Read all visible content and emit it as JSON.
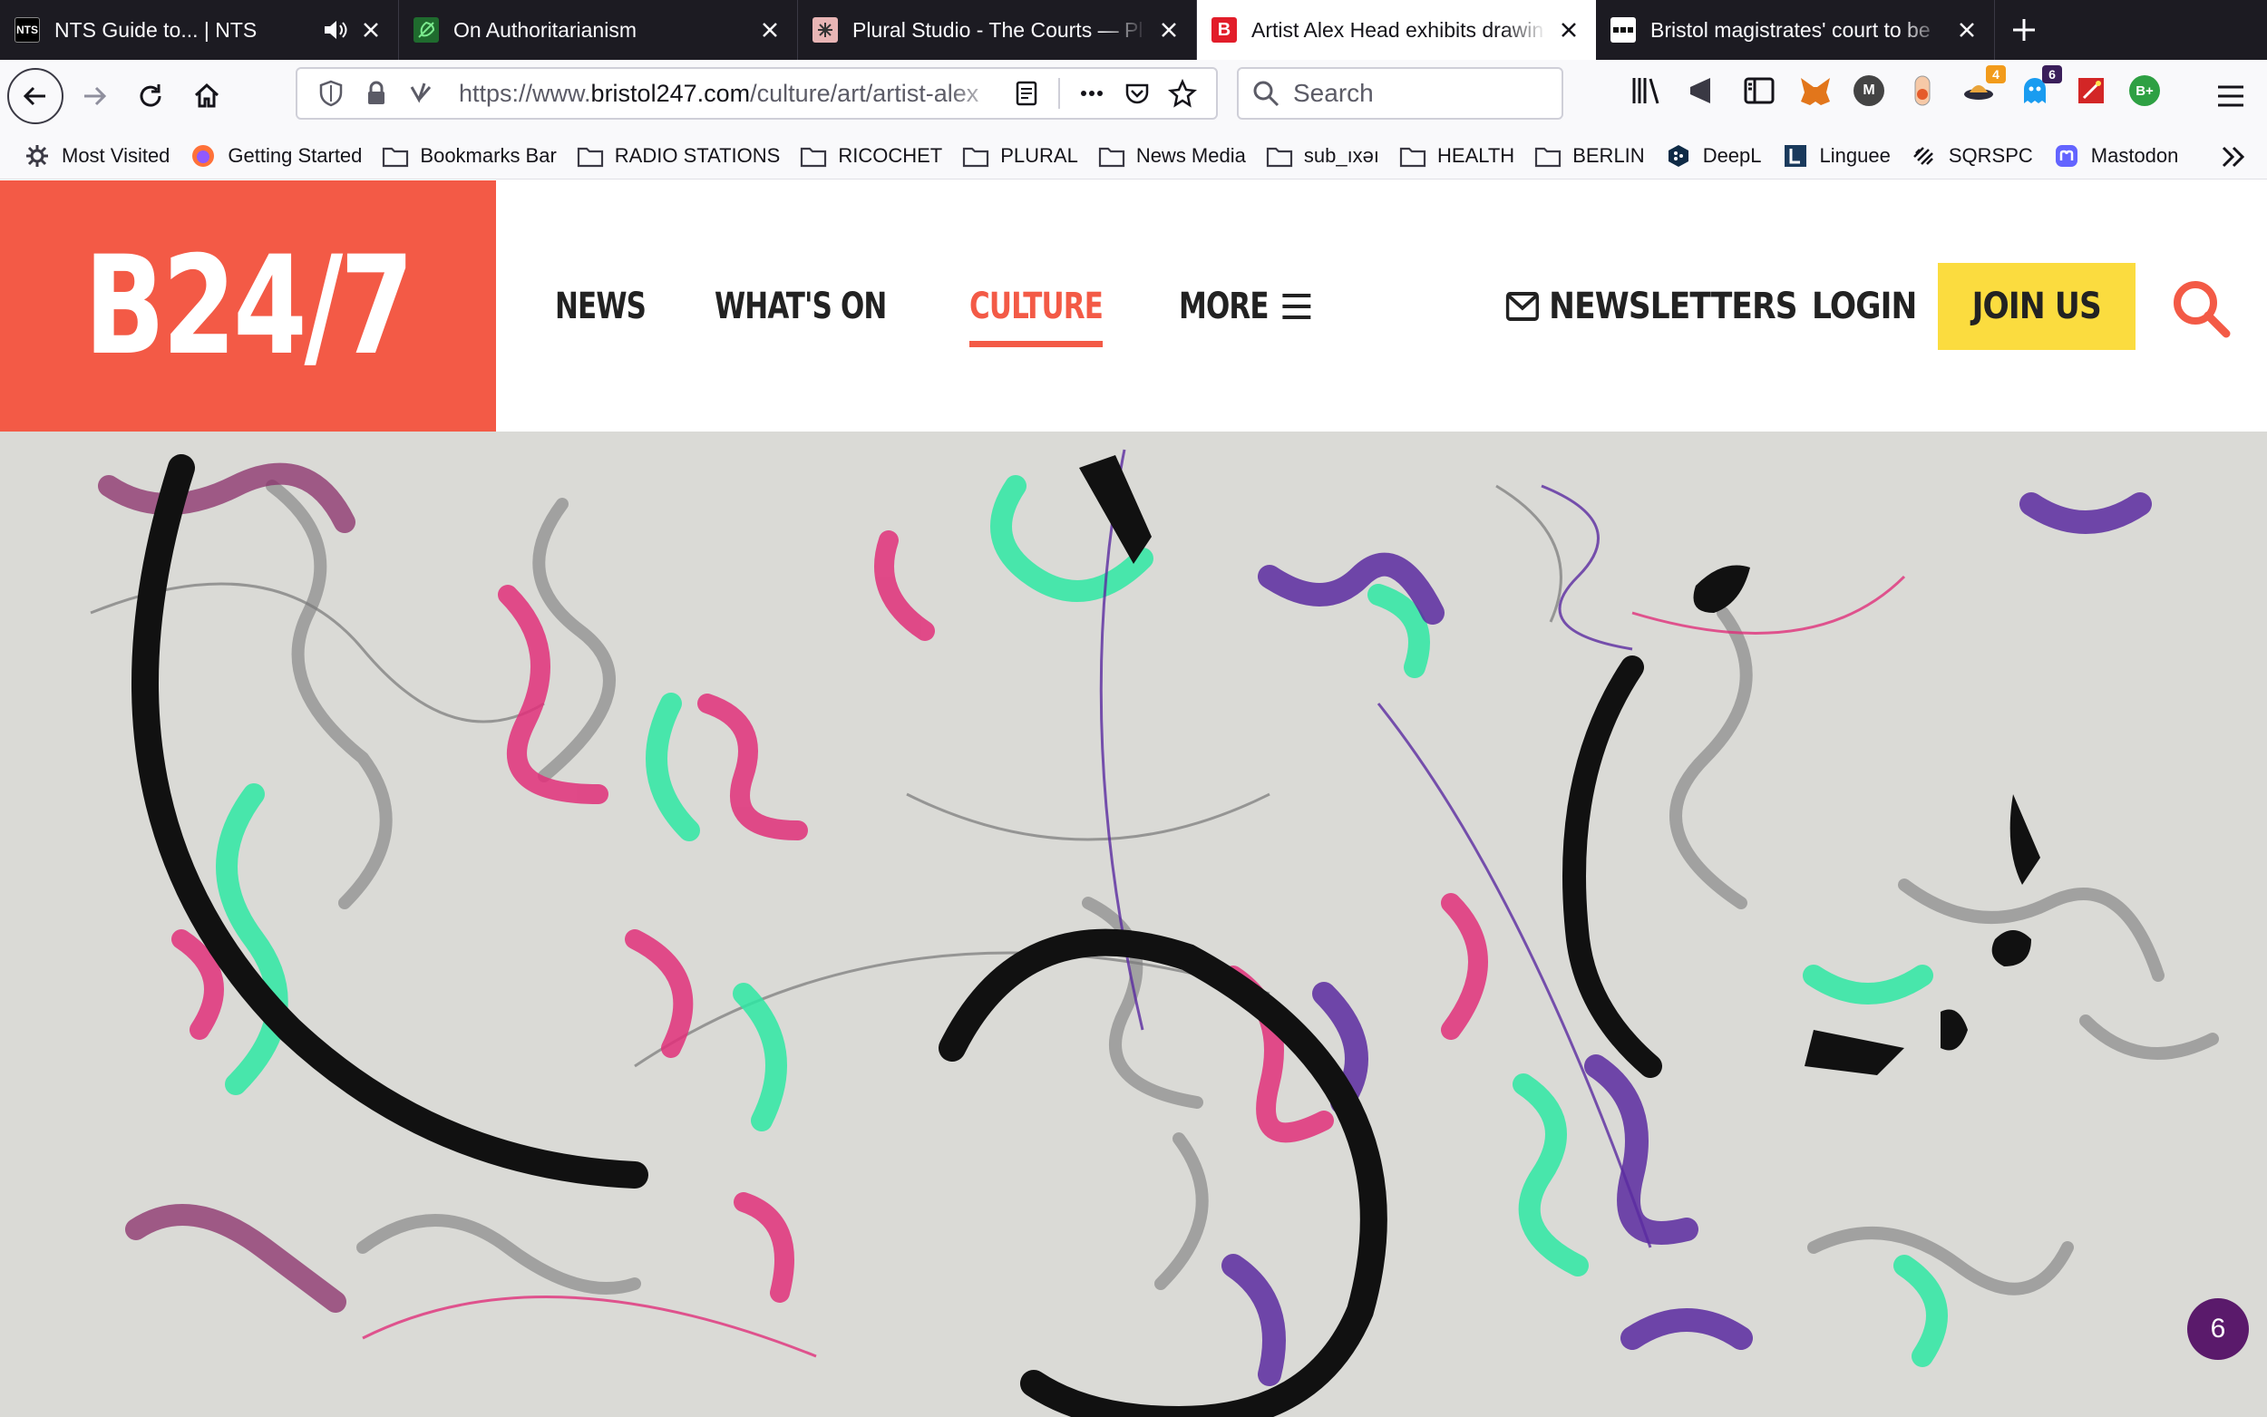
{
  "browser": {
    "tabs": [
      {
        "title": "NTS Guide to... | NTS",
        "favicon": "nts-favicon",
        "audio": true,
        "active": false
      },
      {
        "title": "On Authoritarianism",
        "favicon": "leaf-favicon",
        "active": false
      },
      {
        "title": "Plural Studio - The Courts — Pl",
        "favicon": "plural-favicon",
        "active": false
      },
      {
        "title": "Artist Alex Head exhibits drawin",
        "favicon": "b247-favicon",
        "active": true
      },
      {
        "title": "Bristol magistrates' court to be",
        "favicon": "news-favicon",
        "active": false
      }
    ],
    "url_prefix": "https://www.",
    "url_domain": "bristol247.com",
    "url_path": "/culture/art/artist-alex",
    "search_placeholder": "Search",
    "extension_badges": {
      "ext_orange": "4",
      "ext_blue": "6"
    },
    "extension_labels": {
      "bplus": "B+",
      "m": "M"
    },
    "bookmarks": [
      {
        "label": "Most Visited",
        "icon": "gear-icon"
      },
      {
        "label": "Getting Started",
        "icon": "firefox-icon"
      },
      {
        "label": "Bookmarks Bar",
        "icon": "folder-icon"
      },
      {
        "label": "RADIO STATIONS",
        "icon": "folder-icon"
      },
      {
        "label": "RICOCHET",
        "icon": "folder-icon"
      },
      {
        "label": "PLURAL",
        "icon": "folder-icon"
      },
      {
        "label": "News Media",
        "icon": "folder-icon"
      },
      {
        "label": "sub_ıxǝı",
        "icon": "folder-icon"
      },
      {
        "label": "HEALTH",
        "icon": "folder-icon"
      },
      {
        "label": "BERLIN",
        "icon": "folder-icon"
      },
      {
        "label": "DeepL",
        "icon": "deepl-icon"
      },
      {
        "label": "Linguee",
        "icon": "linguee-icon"
      },
      {
        "label": "SQRSPC",
        "icon": "squarespace-icon"
      },
      {
        "label": "Mastodon",
        "icon": "mastodon-icon"
      }
    ]
  },
  "site": {
    "logo": "B24/7",
    "nav": {
      "news": "NEWS",
      "whats_on": "WHAT'S ON",
      "culture": "CULTURE",
      "more": "MORE"
    },
    "newsletters": "NEWSLETTERS",
    "login": "LOGIN",
    "join": "JOIN US",
    "colors": {
      "brand": "#f35a46",
      "join": "#fbdc3f",
      "counter": "#5a1a6b"
    }
  },
  "hero": {
    "counter": "6"
  }
}
